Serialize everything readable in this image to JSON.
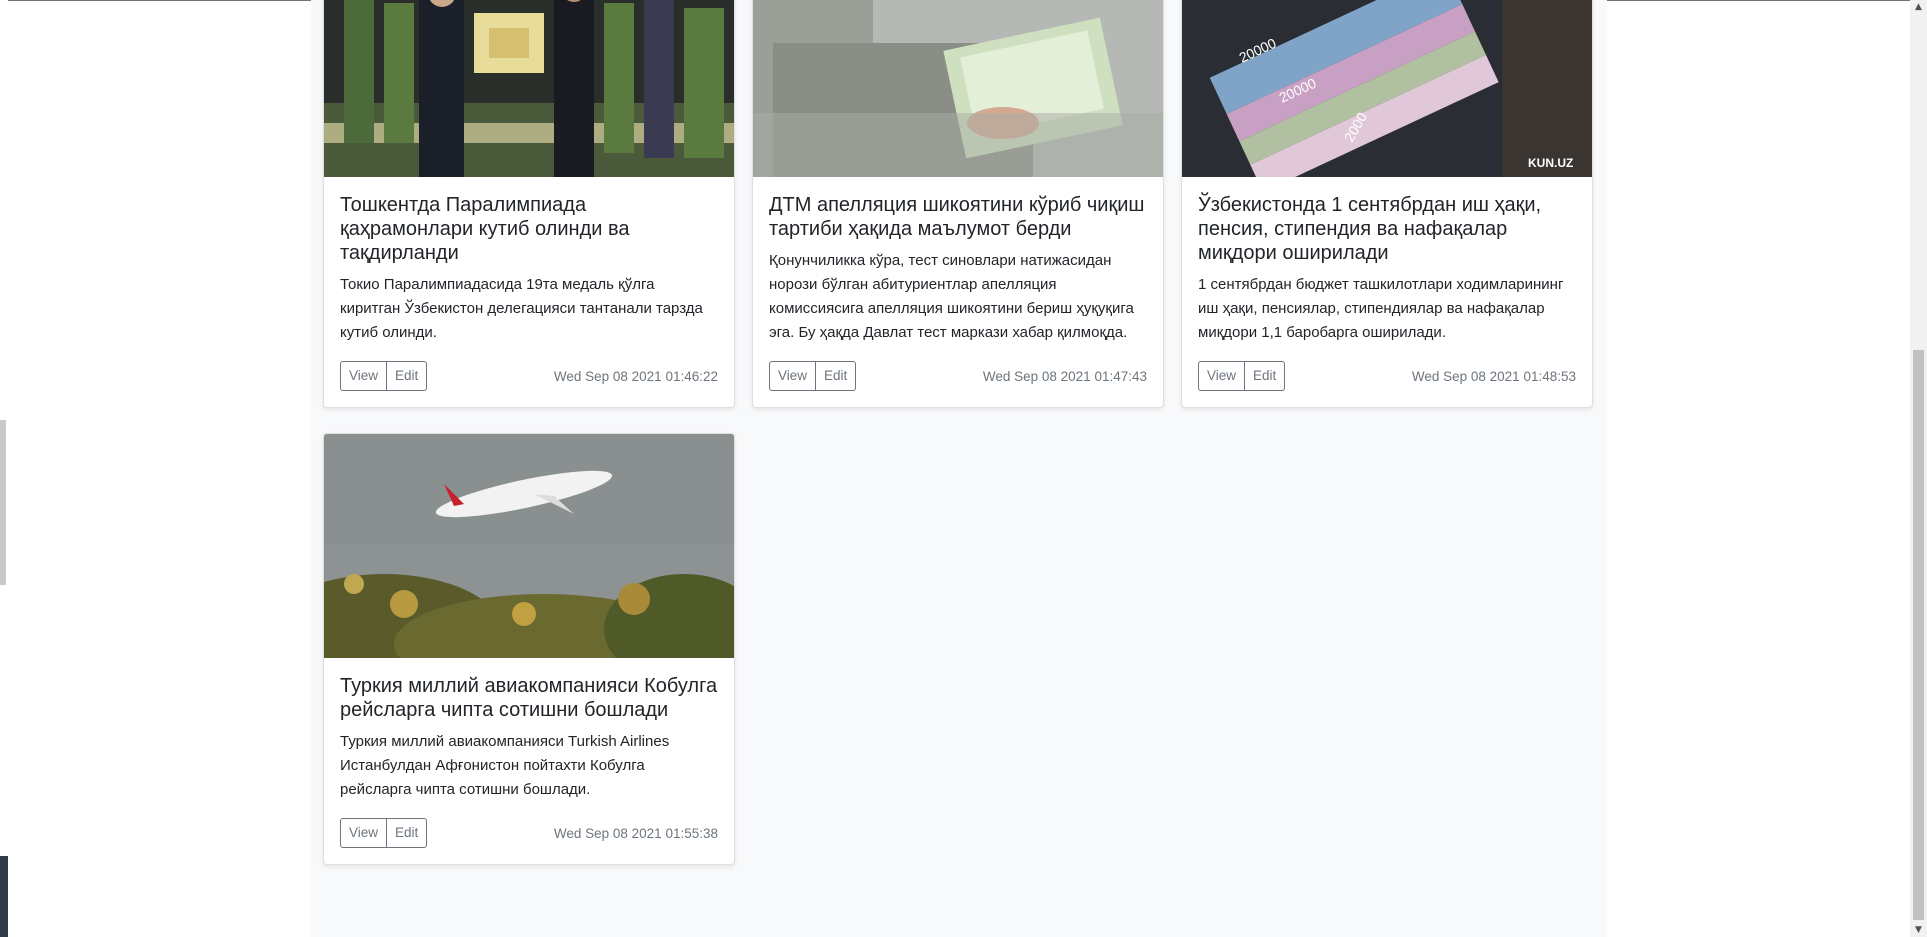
{
  "cards": [
    {
      "title": "Тошкентда Паралимпиада қаҳрамонлари кутиб олинди ва тақдирланди",
      "text": "Токио Паралимпиадасида 19та медаль қўлга киритган Ўзбекистон делегацияси тантанали тарзда кутиб олинди.",
      "view_label": "View",
      "edit_label": "Edit",
      "date": "Wed Sep 08 2021 01:46:22"
    },
    {
      "title": "ДТМ апелляция шикоятини кўриб чиқиш тартиби ҳақида маълумот берди",
      "text": "Қонунчиликка кўра, тест синовлари натижасидан норози бўлган абитуриентлар апелляция комиссиясига апелляция шикоятини бериш ҳуқуқига эга. Бу ҳақда Давлат тест маркази хабар қилмоқда.",
      "view_label": "View",
      "edit_label": "Edit",
      "date": "Wed Sep 08 2021 01:47:43"
    },
    {
      "title": "Ўзбекистонда 1 сентябрдан иш ҳақи, пенсия, стипендия ва нафақалар миқдори оширилади",
      "text": "1 сентябрдан бюджет ташкилотлари ходимларининг иш ҳақи, пенсиялар, стипендиялар ва нафақалар миқдори 1,1 баробарга оширилади.",
      "view_label": "View",
      "edit_label": "Edit",
      "date": "Wed Sep 08 2021 01:48:53",
      "image_watermark": "KUN.UZ",
      "banknote_value": "20000",
      "banknote_value_small": "2000"
    },
    {
      "title": "Туркия миллий авиакомпанияси Кобулга рейсларга чипта сотишни бошлади",
      "text": "Туркия миллий авиакомпанияси Turkish Airlines Истанбулдан Афғонистон пойтахти Кобулга рейсларга чипта сотишни бошлади.",
      "view_label": "View",
      "edit_label": "Edit",
      "date": "Wed Sep 08 2021 01:55:38"
    }
  ],
  "colors": {
    "page_bg": "#f8f9fa",
    "card_bg": "#ffffff",
    "muted": "#6c757d",
    "text": "#212529"
  }
}
